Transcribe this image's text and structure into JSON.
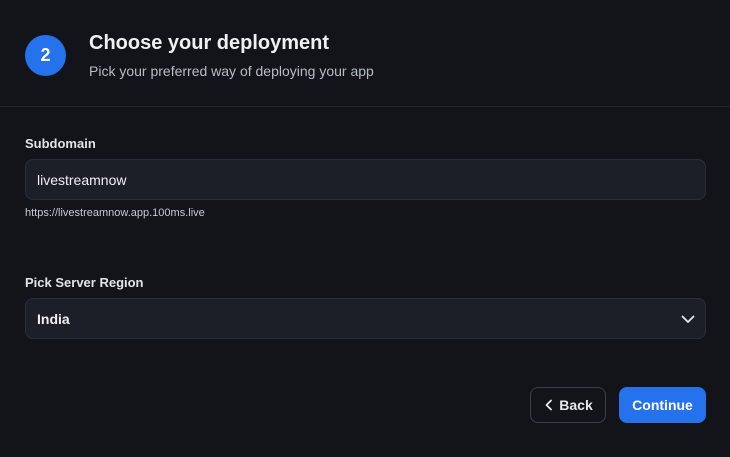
{
  "header": {
    "step_number": "2",
    "title": "Choose your deployment",
    "subtitle": "Pick your preferred way of deploying your app"
  },
  "subdomain": {
    "label": "Subdomain",
    "value": "livestreamnow",
    "hint_url": "https://livestreamnow.app.100ms.live"
  },
  "region": {
    "label": "Pick Server Region",
    "selected": "India",
    "icon": "chevron-down-icon"
  },
  "actions": {
    "back_label": "Back",
    "back_icon": "chevron-left-icon",
    "continue_label": "Continue"
  },
  "colors": {
    "background": "#121419",
    "accent": "#2572ed",
    "input_bg": "#1c1f27"
  }
}
